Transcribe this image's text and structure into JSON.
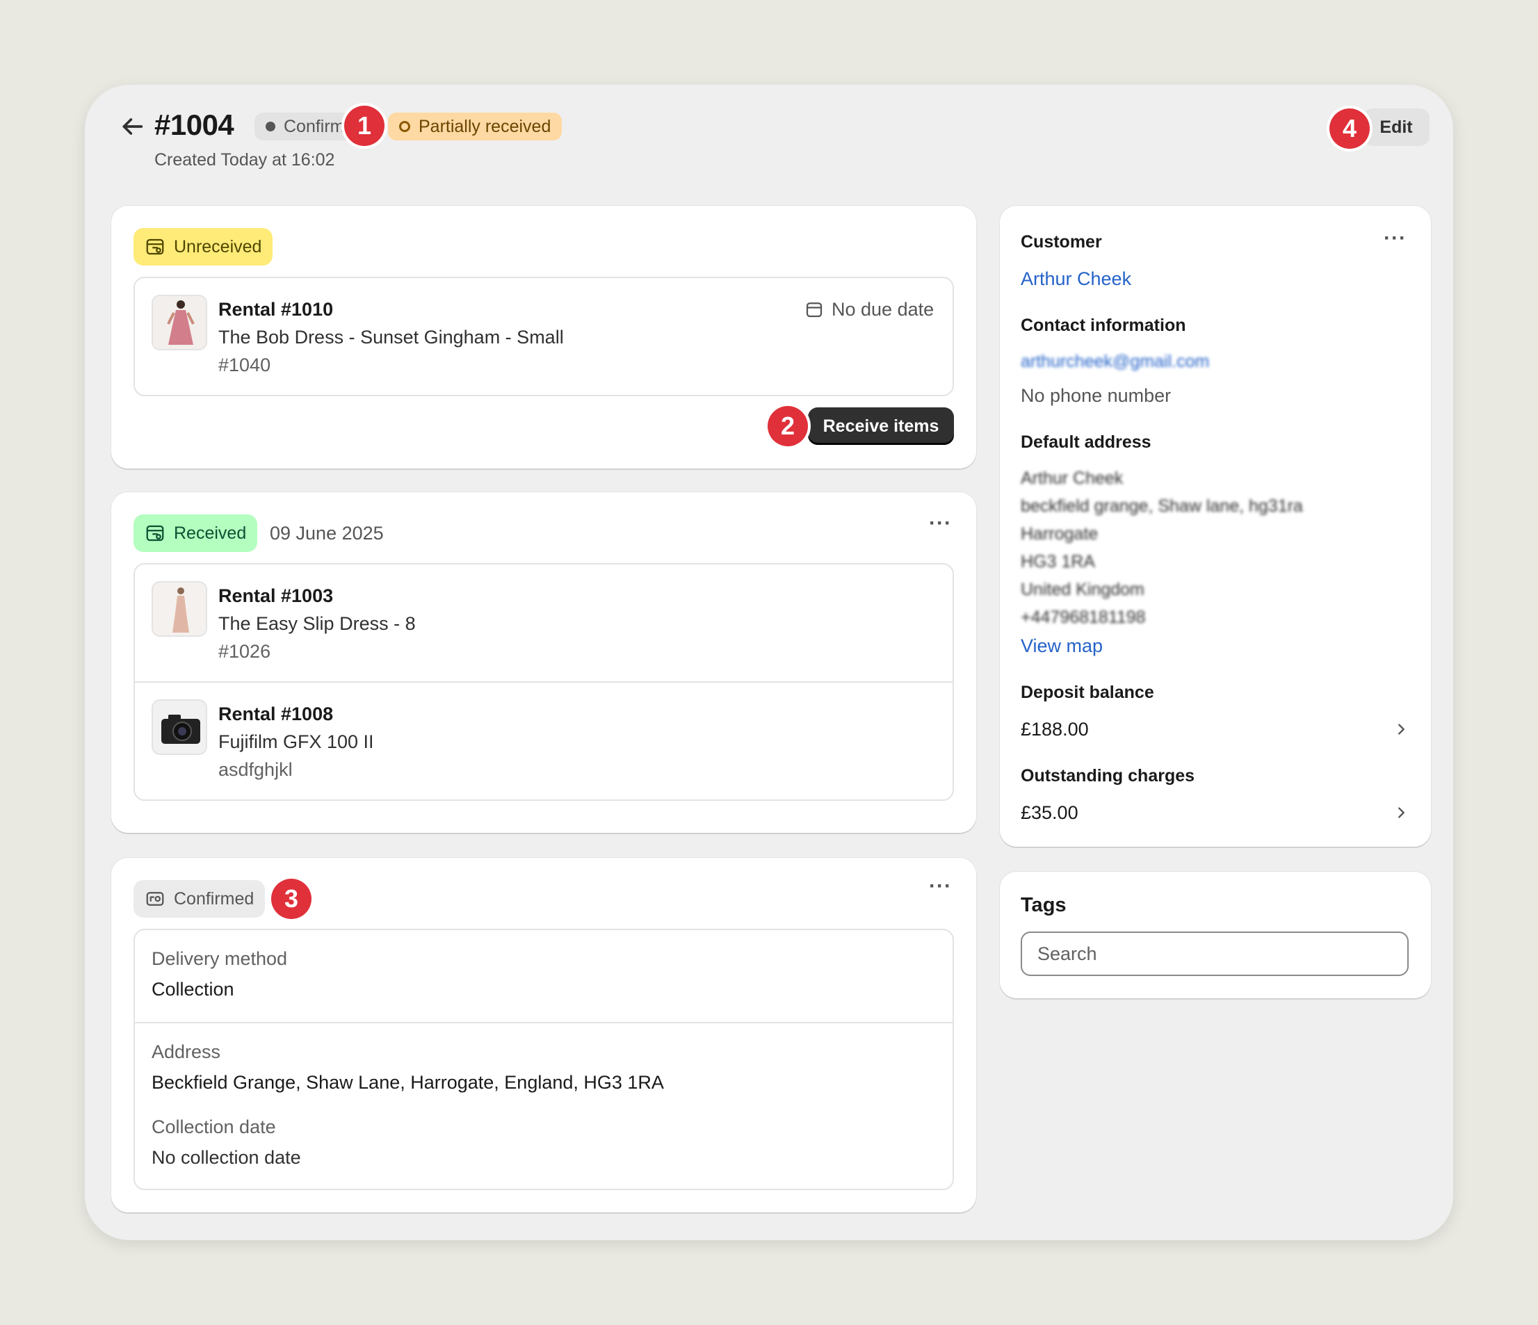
{
  "header": {
    "order_title": "#1004",
    "status_confirmed": "Confirmed",
    "status_partial": "Partially received",
    "created": "Created Today at 16:02",
    "edit_label": "Edit"
  },
  "markers": [
    "1",
    "2",
    "3",
    "4"
  ],
  "unreceived": {
    "status": "Unreceived",
    "item": {
      "title": "Rental #1010",
      "name": "The Bob Dress - Sunset Gingham - Small",
      "ref": "#1040",
      "due": "No due date"
    },
    "receive_button": "Receive items"
  },
  "received": {
    "status": "Received",
    "date": "09 June 2025",
    "items": [
      {
        "title": "Rental #1003",
        "name": "The Easy Slip Dress - 8",
        "ref": "#1026"
      },
      {
        "title": "Rental #1008",
        "name": "Fujifilm GFX 100 II",
        "ref": "asdfghjkl"
      }
    ]
  },
  "confirmed": {
    "status": "Confirmed",
    "delivery_label": "Delivery method",
    "delivery_value": "Collection",
    "address_label": "Address",
    "address_value": "Beckfield Grange, Shaw Lane, Harrogate, England, HG3 1RA",
    "collection_label": "Collection date",
    "collection_value": "No collection date"
  },
  "customer": {
    "heading": "Customer",
    "name": "Arthur Cheek",
    "contact_heading": "Contact information",
    "email_blurred": "arthurcheek@gmail.com",
    "phone": "No phone number",
    "address_heading": "Default address",
    "address_lines_blurred": [
      "Arthur Cheek",
      "beckfield grange, Shaw lane, hg31ra",
      "Harrogate",
      "HG3 1RA",
      "United Kingdom",
      "+447968181198"
    ],
    "view_map": "View map",
    "deposit_heading": "Deposit balance",
    "deposit_value": "£188.00",
    "outstanding_heading": "Outstanding charges",
    "outstanding_value": "£35.00"
  },
  "tags": {
    "heading": "Tags",
    "search_placeholder": "Search"
  },
  "colors": {
    "background": "#e9e9e2",
    "frame": "#efefef",
    "unreceived_badge": "#ffeb78",
    "received_badge": "#b4fec0",
    "partial_badge": "#ffd9a3",
    "link": "#2563c9",
    "marker": "#e0303a",
    "primary_button": "#303030"
  }
}
